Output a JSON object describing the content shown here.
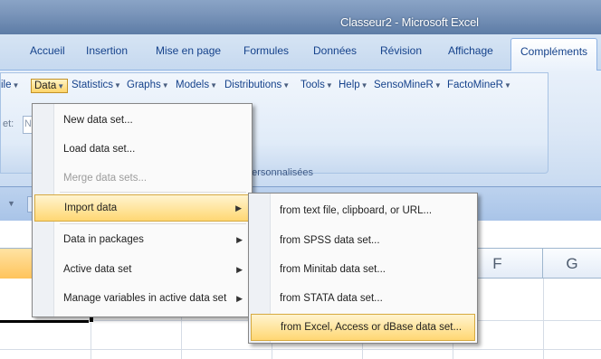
{
  "window": {
    "title": "Classeur2 - Microsoft Excel"
  },
  "ribbon_tabs": [
    {
      "label": "Accueil",
      "active": false
    },
    {
      "label": "Insertion",
      "active": false
    },
    {
      "label": "Mise en page",
      "active": false
    },
    {
      "label": "Formules",
      "active": false
    },
    {
      "label": "Données",
      "active": false
    },
    {
      "label": "Révision",
      "active": false
    },
    {
      "label": "Affichage",
      "active": false
    },
    {
      "label": "Compléments",
      "active": true
    }
  ],
  "rcmdr_menubar": [
    {
      "label": "ile"
    },
    {
      "label": "Data",
      "active": true
    },
    {
      "label": "Statistics"
    },
    {
      "label": "Graphs"
    },
    {
      "label": "Models"
    },
    {
      "label": "Distributions"
    },
    {
      "label": "Tools"
    },
    {
      "label": "Help"
    },
    {
      "label": "SensoMineR"
    },
    {
      "label": "FactoMineR"
    }
  ],
  "dataset_row": {
    "label": "et:",
    "value": "N"
  },
  "ribbon_group_label": "personnalisées",
  "data_menu": {
    "items": [
      {
        "label": "New data set...",
        "enabled": true,
        "submenu": false
      },
      {
        "label": "Load data set...",
        "enabled": true,
        "submenu": false
      },
      {
        "label": "Merge data sets...",
        "enabled": false,
        "submenu": false
      },
      {
        "label": "Import data",
        "enabled": true,
        "submenu": true,
        "highlighted": true
      },
      {
        "label": "Data in packages",
        "enabled": true,
        "submenu": true
      },
      {
        "label": "Active data set",
        "enabled": true,
        "submenu": true
      },
      {
        "label": "Manage variables in active data set",
        "enabled": true,
        "submenu": true
      }
    ]
  },
  "import_submenu": {
    "items": [
      {
        "label": "from text file, clipboard, or URL..."
      },
      {
        "label": "from SPSS data set..."
      },
      {
        "label": "from Minitab data set..."
      },
      {
        "label": "from STATA data set..."
      },
      {
        "label": "from Excel, Access or dBase data set...",
        "highlighted": true
      }
    ]
  },
  "sheet": {
    "column_headers": [
      "F",
      "G"
    ]
  },
  "colors": {
    "title_bar": "#7a95ba",
    "ribbon_text": "#15428b",
    "menu_highlight": "#ffd773",
    "column_header_selected": "#ffc45c"
  },
  "icons": {
    "dropdown_arrow": "dropdown-arrow-icon",
    "submenu_arrow": "submenu-arrow-icon"
  }
}
